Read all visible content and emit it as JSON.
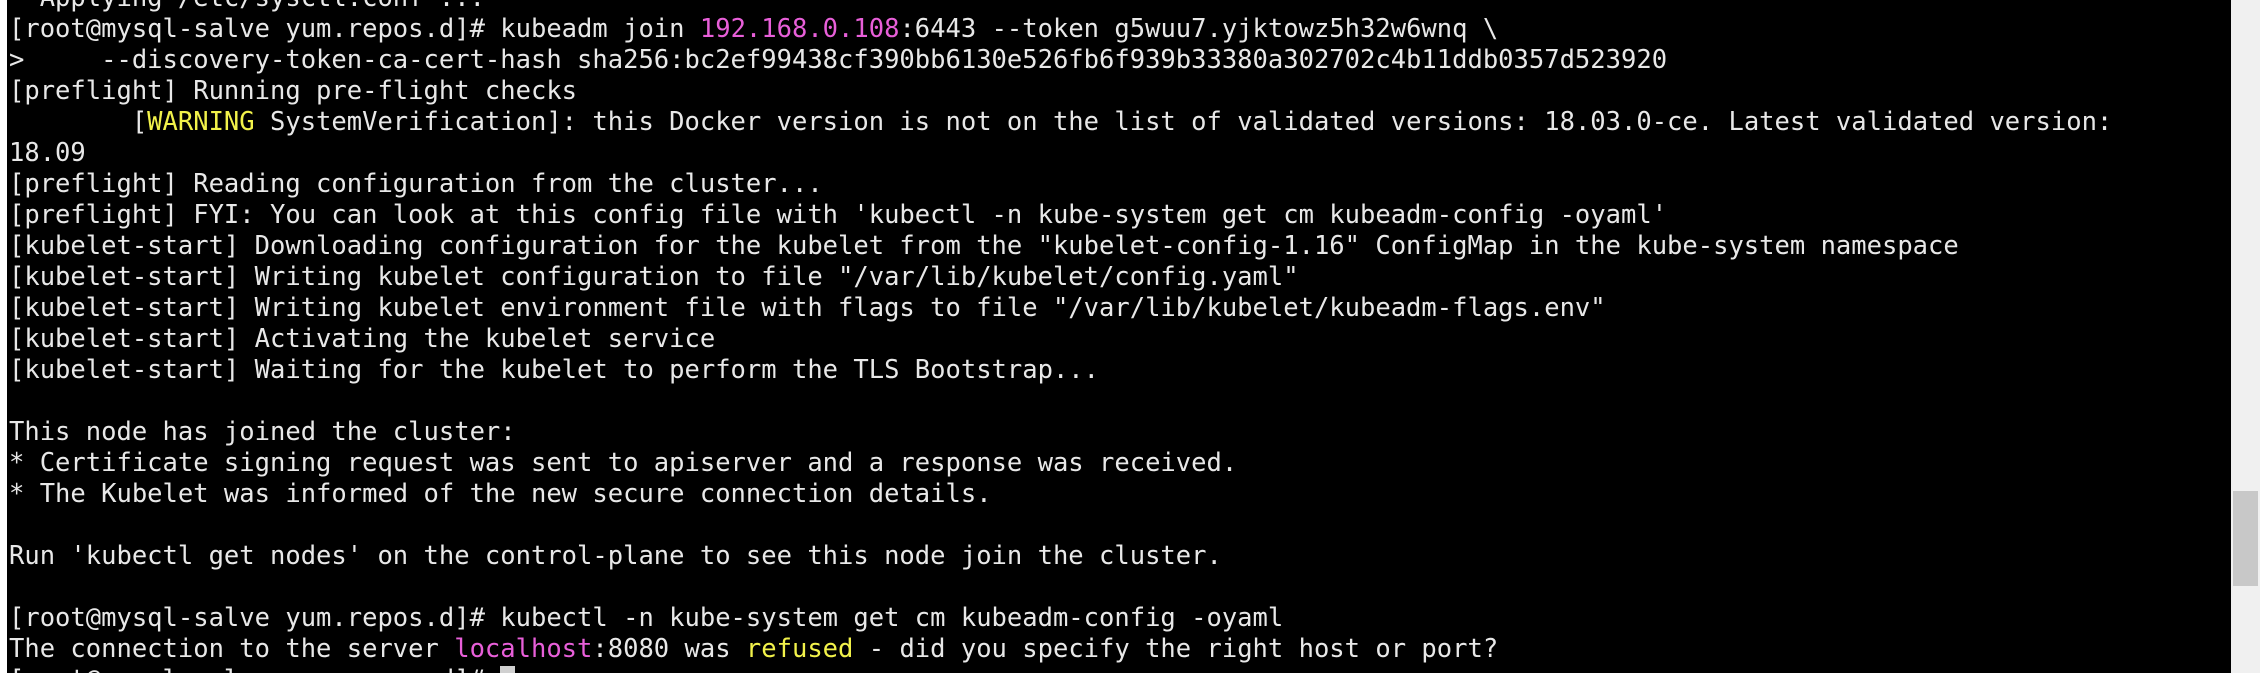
{
  "colors": {
    "background": "#000000",
    "text": "#e8e8e8",
    "magenta": "#e85fd9",
    "yellow": "#f2f24a",
    "scrollbar_track": "#f0f0f0",
    "scrollbar_thumb": "#c8c8c8"
  },
  "terminal": {
    "lines": [
      {
        "segments": [
          {
            "text": "  Applying /etc/sysctl.conf ..."
          }
        ]
      },
      {
        "segments": [
          {
            "text": "[root@mysql-salve yum.repos.d]# kubeadm join "
          },
          {
            "text": "192.168.0.108",
            "style": "ip"
          },
          {
            "text": ":6443 --token g5wuu7.yjktowz5h32w6wnq \\"
          }
        ]
      },
      {
        "segments": [
          {
            "text": ">     --discovery-token-ca-cert-hash sha256:bc2ef99438cf390bb6130e526fb6f939b33380a302702c4b11ddb0357d523920"
          }
        ]
      },
      {
        "segments": [
          {
            "text": "[preflight] Running pre-flight checks"
          }
        ]
      },
      {
        "segments": [
          {
            "text": "        ["
          },
          {
            "text": "WARNING",
            "style": "warn"
          },
          {
            "text": " SystemVerification]: this Docker version is not on the list of validated versions: 18.03.0-ce. Latest validated version:"
          }
        ]
      },
      {
        "segments": [
          {
            "text": "18.09"
          }
        ]
      },
      {
        "segments": [
          {
            "text": "[preflight] Reading configuration from the cluster..."
          }
        ]
      },
      {
        "segments": [
          {
            "text": "[preflight] FYI: You can look at this config file with 'kubectl -n kube-system get cm kubeadm-config -oyaml'"
          }
        ]
      },
      {
        "segments": [
          {
            "text": "[kubelet-start] Downloading configuration for the kubelet from the \"kubelet-config-1.16\" ConfigMap in the kube-system namespace"
          }
        ]
      },
      {
        "segments": [
          {
            "text": "[kubelet-start] Writing kubelet configuration to file \"/var/lib/kubelet/config.yaml\""
          }
        ]
      },
      {
        "segments": [
          {
            "text": "[kubelet-start] Writing kubelet environment file with flags to file \"/var/lib/kubelet/kubeadm-flags.env\""
          }
        ]
      },
      {
        "segments": [
          {
            "text": "[kubelet-start] Activating the kubelet service"
          }
        ]
      },
      {
        "segments": [
          {
            "text": "[kubelet-start] Waiting for the kubelet to perform the TLS Bootstrap..."
          }
        ]
      },
      {
        "segments": [
          {
            "text": ""
          }
        ]
      },
      {
        "segments": [
          {
            "text": "This node has joined the cluster:"
          }
        ]
      },
      {
        "segments": [
          {
            "text": "* Certificate signing request was sent to apiserver and a response was received."
          }
        ]
      },
      {
        "segments": [
          {
            "text": "* The Kubelet was informed of the new secure connection details."
          }
        ]
      },
      {
        "segments": [
          {
            "text": ""
          }
        ]
      },
      {
        "segments": [
          {
            "text": "Run 'kubectl get nodes' on the control-plane to see this node join the cluster."
          }
        ]
      },
      {
        "segments": [
          {
            "text": ""
          }
        ]
      },
      {
        "segments": [
          {
            "text": "[root@mysql-salve yum.repos.d]# kubectl -n kube-system get cm kubeadm-config -oyaml"
          }
        ]
      },
      {
        "segments": [
          {
            "text": "The connection to the server "
          },
          {
            "text": "localhost",
            "style": "host"
          },
          {
            "text": ":8080 was "
          },
          {
            "text": "refused",
            "style": "refused"
          },
          {
            "text": " - did you specify the right host or port?"
          }
        ]
      },
      {
        "segments": [
          {
            "text": "[root@mysql-salve yum.repos.d]# "
          }
        ],
        "cursor": true
      }
    ]
  },
  "scrollbar": {
    "position_fraction": 0.85
  }
}
